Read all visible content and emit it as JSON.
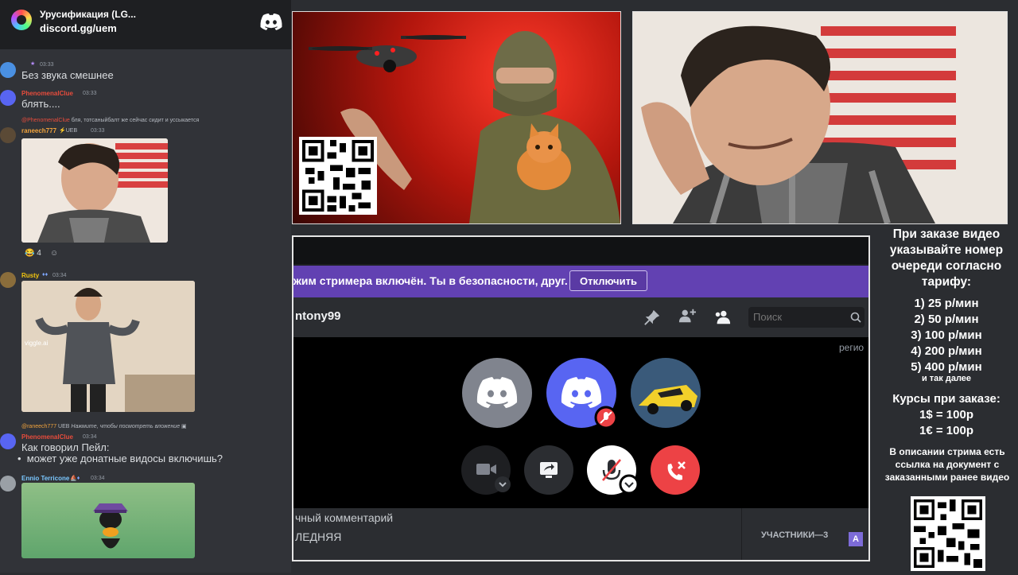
{
  "chat": {
    "server_name": "Урусификация (LG...",
    "server_invite": "discord.gg/uem",
    "messages": [
      {
        "time": "03:33",
        "text": "Без звука смешнее"
      },
      {
        "user": "PhenomenalClue",
        "time": "03:33",
        "text": "блять...."
      },
      {
        "reply_to": "@PhenomenalClue",
        "reply_text": "бля, тотсаныйбалт же сейчас сидит и уссыкается",
        "user": "raneech777",
        "badge": "UEB",
        "time": "03:33",
        "reaction_count": "4"
      },
      {
        "user": "Rusty",
        "time": "03:34",
        "watermark": "viggle.ai"
      },
      {
        "reply_to": "@raneech777",
        "reply_badge": "UEB",
        "reply_text": "Нажмите, чтобы посмотреть вложение",
        "user": "PhenomenalClue",
        "time": "03:34",
        "text": "Как говорил Пейл:",
        "bullet": "может уже донатные видосы включишь?"
      },
      {
        "user": "Ennio Terricone",
        "time": "03:34"
      }
    ]
  },
  "call": {
    "streamer_text": "жим стримера включён. Ты в безопасности, друг.",
    "streamer_button": "Отключить",
    "dm_name": "ntony99",
    "search_placeholder": "Поиск",
    "region_label": "регио",
    "comment_label": "чный комментарий",
    "last_label": "ЛЕДНЯЯ",
    "members_label": "УЧАСТНИКИ—3",
    "members_avatar_letter": "A"
  },
  "info": {
    "title": "При заказе видео указывайте номер очереди согласно тарифу:",
    "tariffs": [
      "1) 25 р/мин",
      "2) 50 р/мин",
      "3) 100 р/мин",
      "4) 200 р/мин",
      "5) 400 р/мин"
    ],
    "etc": "и так далее",
    "rates_title": "Курсы при заказе:",
    "rates": [
      "1$ = 100р",
      "1€ = 100р"
    ],
    "description": "В описании стрима есть ссылка на документ с заказанными ранее видео"
  },
  "colors": {
    "discord_blurple": "#5865f2",
    "streamer_bar": "#6241b2",
    "hangup_red": "#ed4245",
    "chat_bg": "#313338"
  }
}
